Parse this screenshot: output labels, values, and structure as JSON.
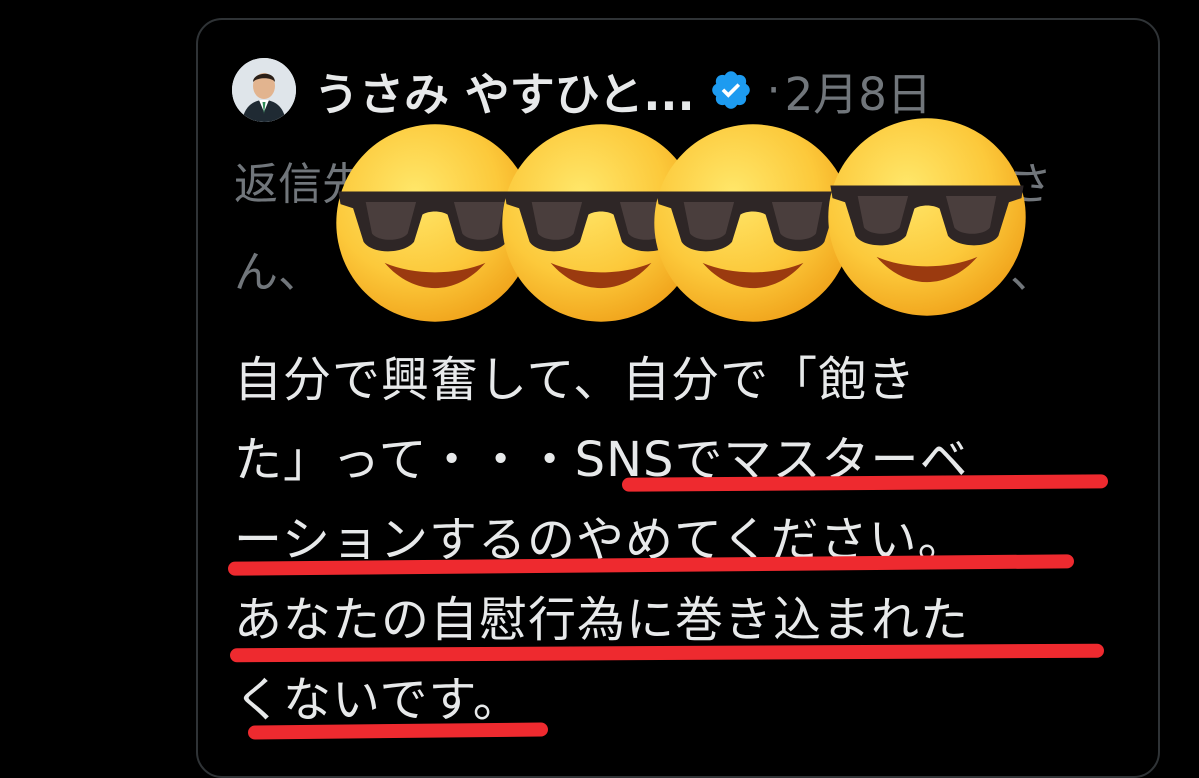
{
  "post": {
    "author_name": "うさみ やすひと...",
    "separator": "·",
    "date": "2月8日",
    "reply_line_1": "返信先：@",
    "reply_line_1_end": "さ",
    "reply_line_2": "ん、",
    "reply_line_2_end": "、",
    "body_lines": [
      "自分で興奮して、自分で「飽き",
      "た」って・・・SNSでマスターベ",
      "ーションするのやめてください。",
      "あなたの自慰行為に巻き込まれた",
      "くないです。"
    ]
  },
  "overlay": {
    "emoji_name": "smiling-face-with-sunglasses",
    "count": 4
  },
  "colors": {
    "background": "#000000",
    "primary_text": "#e7e9ea",
    "secondary_text": "#71767b",
    "verified_badge": "#1d9bf0",
    "underline": "#ee2a2f",
    "card_border": "#2f3336"
  }
}
